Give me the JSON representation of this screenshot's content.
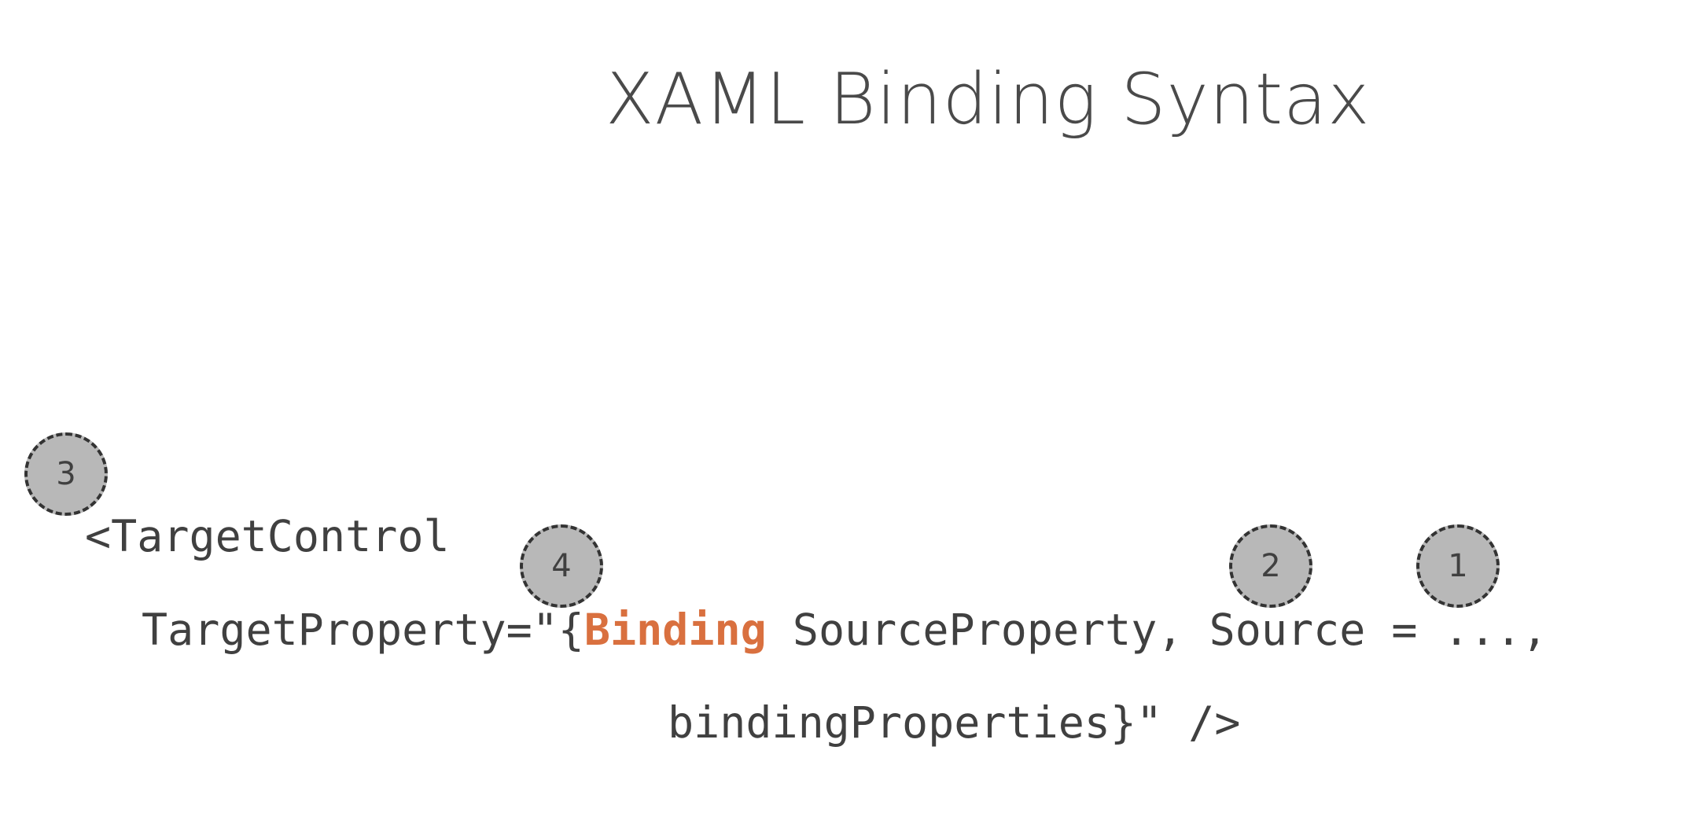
{
  "slide": {
    "title": "XAML Binding Syntax"
  },
  "code": {
    "line1": "<TargetControl",
    "line2_prefix": "TargetProperty=\"{",
    "line2_keyword": "Binding",
    "line2_suffix": " SourceProperty, Source = ...,",
    "line3": "bindingProperties}\" />"
  },
  "markers": {
    "m1": "1",
    "m2": "2",
    "m3": "3",
    "m4": "4"
  },
  "colors": {
    "keyword": "#d9703f",
    "text": "#404040",
    "marker_fill": "#b8b8b8",
    "marker_border": "#333333"
  }
}
